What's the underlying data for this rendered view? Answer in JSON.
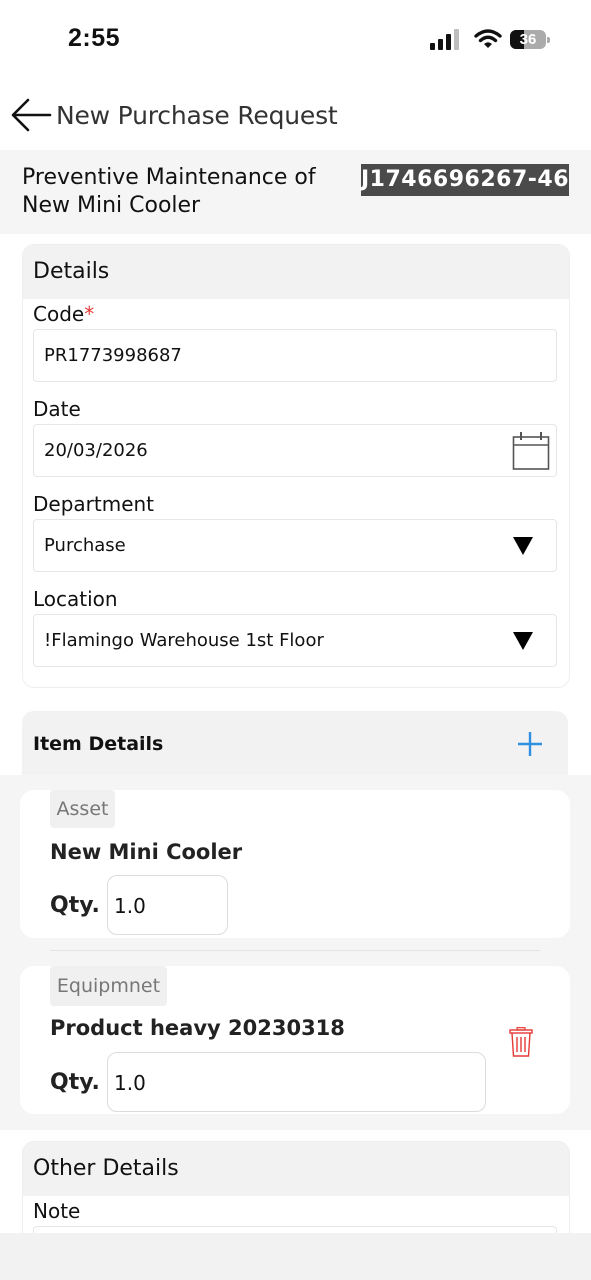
{
  "status_bar": {
    "time": "2:55",
    "battery": "36"
  },
  "header": {
    "title": "New Purchase Request",
    "back_icon": "arrow-left-icon"
  },
  "context": {
    "title": "Preventive Maintenance of New Mini Cooler",
    "job_id": "J1746696267-46"
  },
  "details": {
    "title": "Details",
    "code": {
      "label": "Code",
      "required_mark": "*",
      "value": "PR1773998687"
    },
    "date": {
      "label": "Date",
      "value": "20/03/2026",
      "icon": "calendar-icon"
    },
    "department": {
      "label": "Department",
      "value": "Purchase",
      "icon": "dropdown-triangle-icon"
    },
    "location": {
      "label": "Location",
      "value": "!Flamingo Warehouse 1st Floor",
      "icon": "dropdown-triangle-icon"
    }
  },
  "item_details": {
    "title": "Item Details",
    "add_icon": "plus-icon",
    "items": [
      {
        "type": "Asset",
        "name": "New Mini Cooler",
        "qty_label": "Qty.",
        "qty": "1.0"
      },
      {
        "type": "Equipmnet",
        "name": "Product heavy 20230318",
        "qty_label": "Qty.",
        "qty": "1.0",
        "delete_icon": "trash-icon"
      }
    ]
  },
  "other_details": {
    "title": "Other Details",
    "note_label": "Note"
  },
  "colors": {
    "accent_blue": "#2f8fe0",
    "delete_red": "#e53935",
    "badge_bg": "#4a4a4a"
  }
}
